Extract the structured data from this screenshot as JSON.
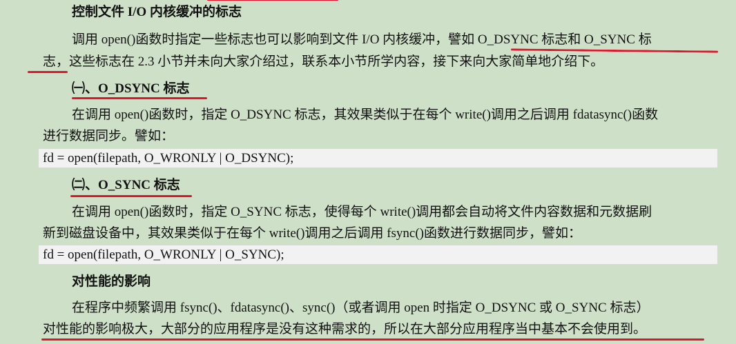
{
  "section_heading_1": "控制文件 I/O 内核缓冲的标志",
  "para_1": {
    "line_1": "调用 open()函数时指定一些标志也可以影响到文件 I/O 内核缓冲，譬如 O_DSYNC 标志和 O_SYNC 标",
    "line_2": "志，这些标志在 2.3 小节并未向大家介绍过，联系本小节所学内容，接下来向大家简单地介绍下。"
  },
  "subsection_1": {
    "heading": "㈠、O_DSYNC 标志",
    "line_1": "在调用 open()函数时，指定 O_DSYNC 标志，其效果类似于在每个 write()调用之后调用 fdatasync()函数",
    "line_2": "进行数据同步。譬如：",
    "code": "fd = open(filepath, O_WRONLY | O_DSYNC);"
  },
  "subsection_2": {
    "heading": "㈡、O_SYNC 标志",
    "line_1": "在调用 open()函数时，指定 O_SYNC 标志，使得每个 write()调用都会自动将文件内容数据和元数据刷",
    "line_2": "新到磁盘设备中，其效果类似于在每个 write()调用之后调用 fsync()函数进行数据同步，譬如：",
    "code": "fd = open(filepath, O_WRONLY | O_SYNC);"
  },
  "section_heading_2": "对性能的影响",
  "para_2": {
    "line_1": "在程序中频繁调用 fsync()、fdatasync()、sync()（或者调用 open 时指定 O_DSYNC 或 O_SYNC 标志）",
    "line_2": "对性能的影响极大，大部分的应用程序是没有这种需求的，所以在大部分应用程序当中基本不会使用到。"
  },
  "colors": {
    "page_background": "#cfe0c9",
    "code_background": "#f2f2f2",
    "annotation_red": "#e0142a"
  }
}
